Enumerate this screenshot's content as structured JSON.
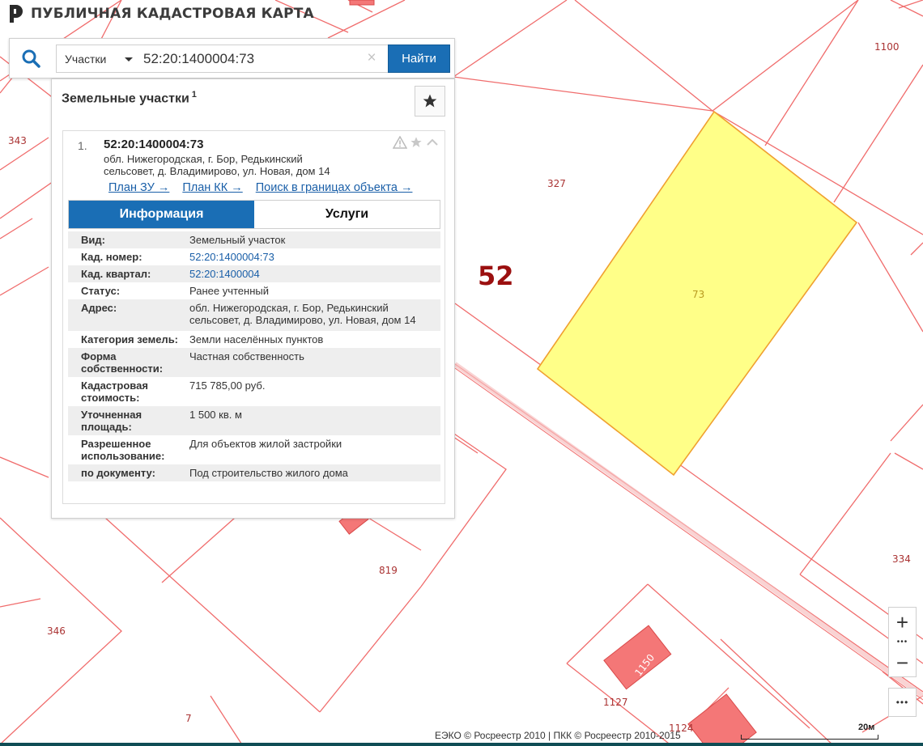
{
  "app": {
    "title": "ПУБЛИЧНАЯ КАДАСТРОВАЯ КАРТА"
  },
  "search": {
    "type_selected": "Участки",
    "query": "52:20:1400004:73",
    "clear_glyph": "×",
    "submit_label": "Найти"
  },
  "panel": {
    "title": "Земельные участки",
    "count": "1",
    "favorite_icon": "star-icon"
  },
  "result": {
    "index": "1.",
    "cad_number": "52:20:1400004:73",
    "address": "обл. Нижегородская, г. Бор, Редькинский сельсовет, д. Владимирово, ул. Новая, дом 14",
    "links": {
      "plan_zu": "План ЗУ →",
      "plan_kk": "План КК →",
      "search_bounds": "Поиск в границах объекта →"
    },
    "tabs": {
      "info": "Информация",
      "services": "Услуги"
    },
    "fields": [
      {
        "label": "Вид:",
        "value": "Земельный участок"
      },
      {
        "label": "Кад. номер:",
        "value": "52:20:1400004:73"
      },
      {
        "label": "Кад. квартал:",
        "value": "52:20:1400004"
      },
      {
        "label": "Статус:",
        "value": "Ранее учтенный"
      },
      {
        "label": "Адрес:",
        "value": "обл. Нижегородская, г. Бор, Редькинский сельсовет, д. Владимирово, ул. Новая, дом 14"
      },
      {
        "label": "Категория земель:",
        "value": "Земли населённых пунктов"
      },
      {
        "label": "Форма собственности:",
        "value": "Частная собственность"
      },
      {
        "label": "Кадастровая стоимость:",
        "value": "715 785,00 руб."
      },
      {
        "label": "Уточненная площадь:",
        "value": "1 500 кв. м"
      },
      {
        "label": "Разрешенное использование:",
        "value": "Для объектов жилой застройки"
      },
      {
        "label": "по документу:",
        "value": "Под строительство жилого дома"
      }
    ]
  },
  "map": {
    "zone_label": "52",
    "parcel_labels": {
      "p1100": "1100",
      "p343": "343",
      "p327": "327",
      "p73": "73",
      "p819": "819",
      "p346": "346",
      "p334": "334",
      "p1150": "1150",
      "p1127": "1127",
      "p7": "7",
      "p1124": "1124"
    },
    "controls": {
      "zoom_in": "+",
      "zoom_dots": "•••",
      "zoom_out": "−",
      "more": "•••"
    },
    "copyright": "ЕЭКО © Росреестр 2010 | ПКК © Росреестр 2010-2015",
    "scale_label": "20м"
  },
  "colors": {
    "parcel_line": "#f06c6c",
    "road": "#f7b0b0",
    "selected_fill": "#ffff88",
    "selected_stroke": "#f0a030",
    "accent": "#1a6eb5",
    "building_fill": "#f47777"
  }
}
